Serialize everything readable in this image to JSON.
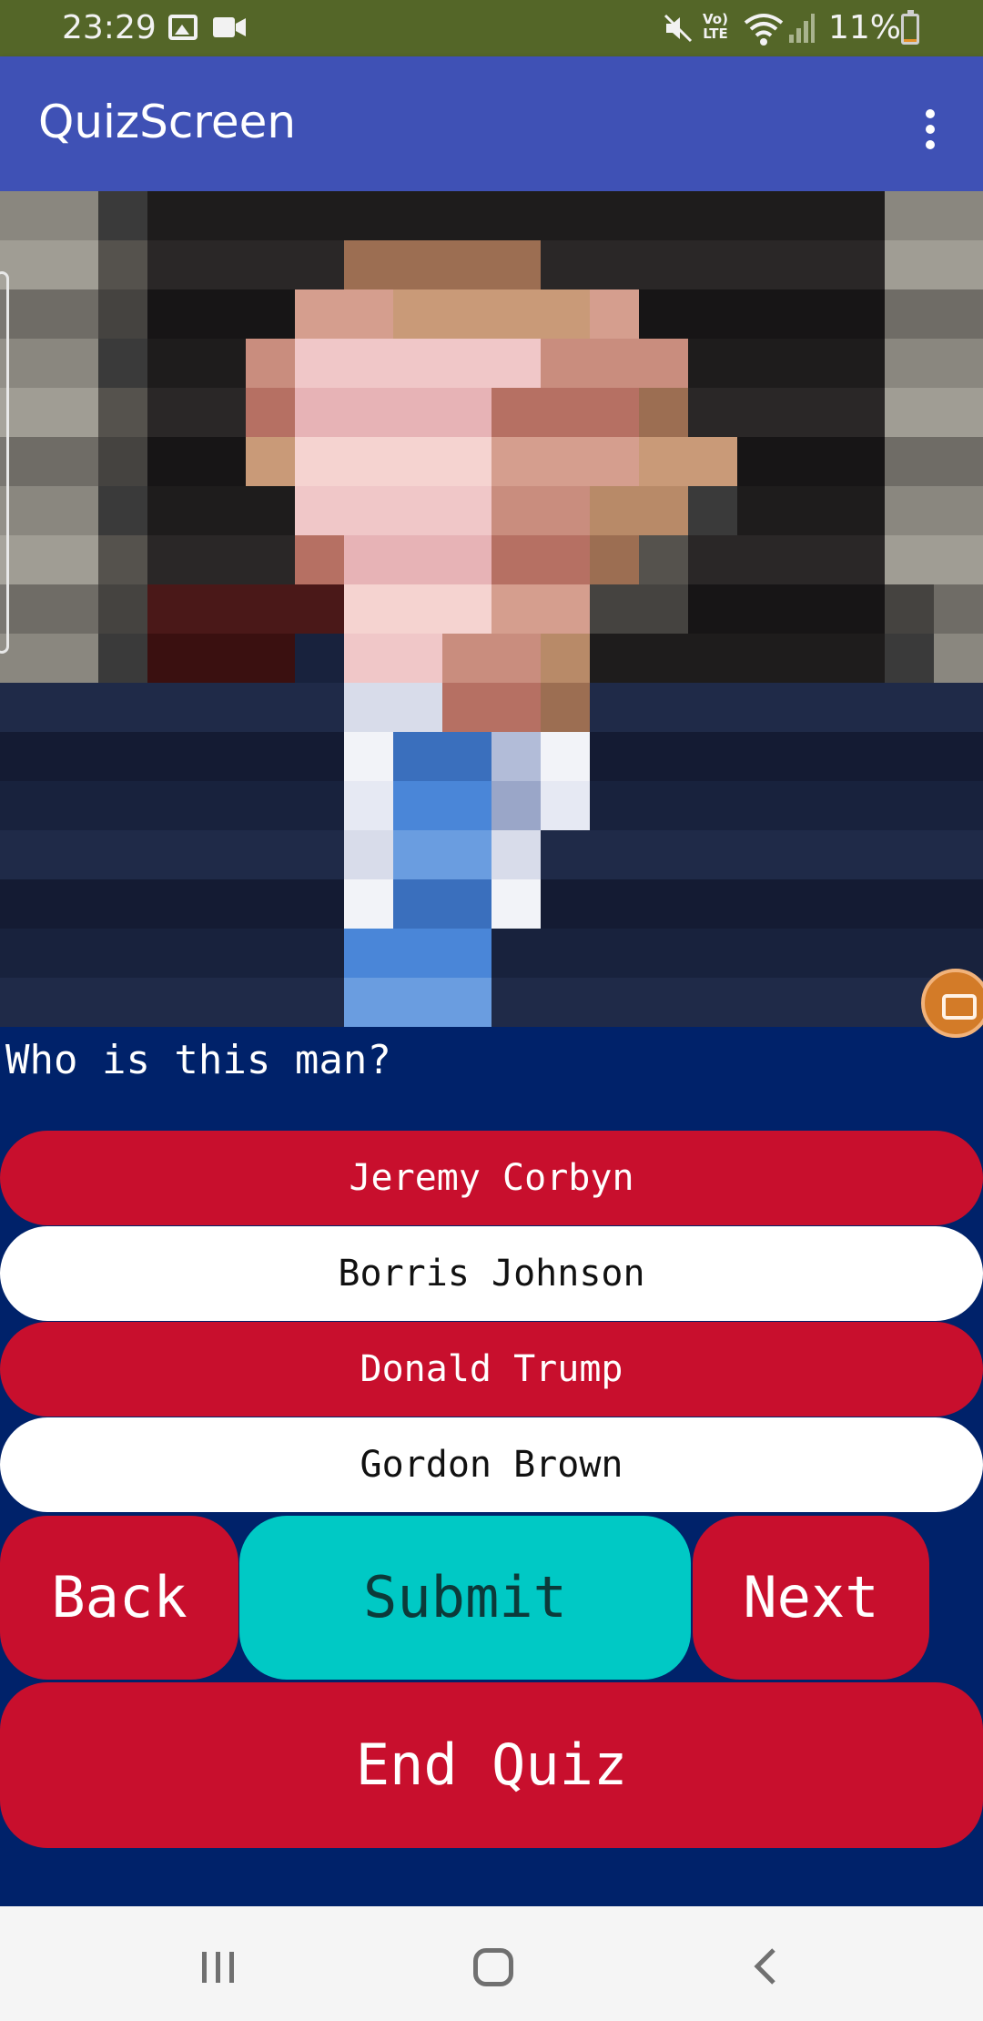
{
  "status_bar": {
    "time": "23:29",
    "battery_percent": "11%",
    "battery_level": 0.11,
    "volte_label_top": "Vo)",
    "volte_label_bottom": "LTE",
    "icons": [
      "gallery-icon",
      "video-icon",
      "mute-icon",
      "volte-icon",
      "wifi-icon",
      "signal-icon",
      "battery-icon"
    ]
  },
  "app_bar": {
    "title": "QuizScreen",
    "menu_icon": "overflow-menu-icon",
    "color": "#3f51b5"
  },
  "question": {
    "image_icon": "pixelated-portrait-image",
    "text": "Who is this man?"
  },
  "options": [
    {
      "label": "Jeremy Corbyn",
      "color": "#c80f2d"
    },
    {
      "label": "Borris Johnson",
      "color": "#ffffff"
    },
    {
      "label": "Donald Trump",
      "color": "#c80f2d"
    },
    {
      "label": "Gordon Brown",
      "color": "#ffffff"
    }
  ],
  "actions": {
    "back": "Back",
    "submit": "Submit",
    "next": "Next",
    "end_quiz": "End Quiz"
  },
  "nav_bar": {
    "icons": [
      "recents-icon",
      "home-icon",
      "back-icon"
    ]
  },
  "colors": {
    "status_bar": "#546628",
    "background": "#00226a",
    "red_button": "#c80f2d",
    "submit_button": "#00c9c5",
    "white_button": "#ffffff"
  }
}
